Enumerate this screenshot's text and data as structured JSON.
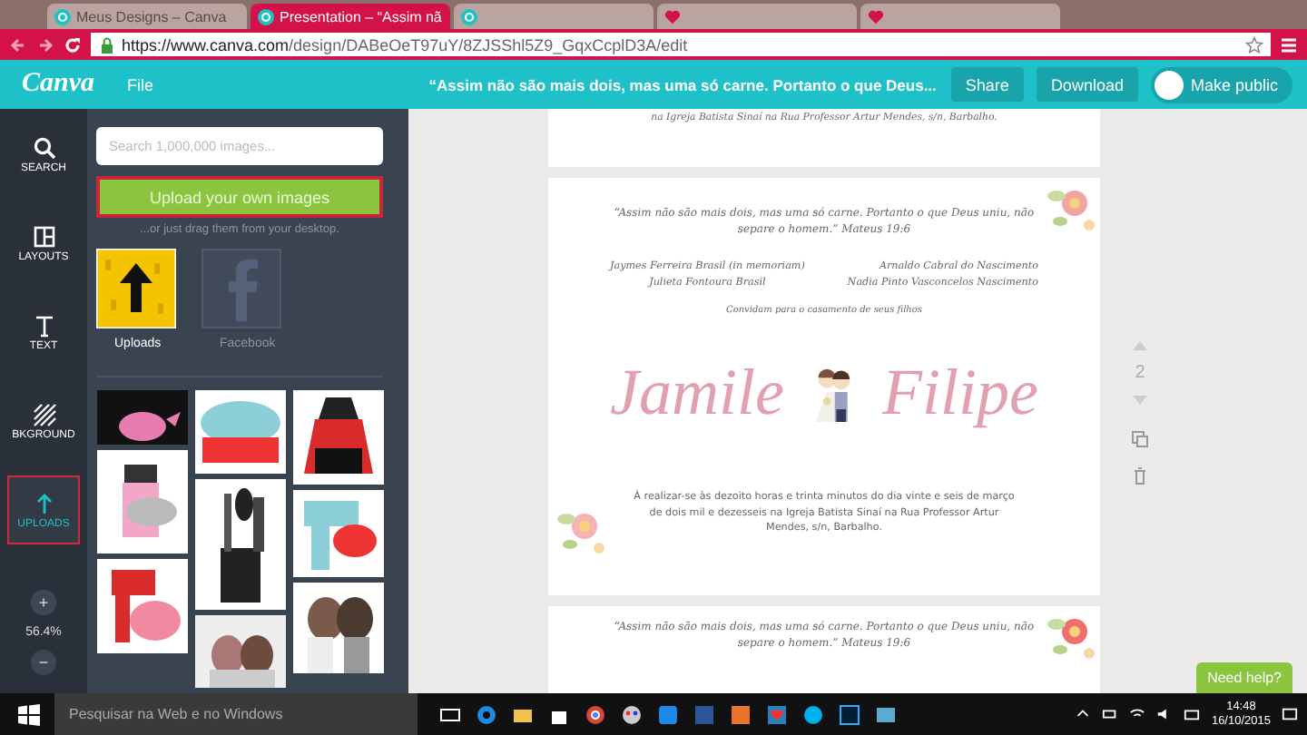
{
  "browser": {
    "tabs": [
      {
        "title": "Meus Designs – Canva",
        "kind": "canva",
        "selected": false
      },
      {
        "title": "Presentation – “Assim nã",
        "kind": "canva",
        "selected": true
      },
      {
        "kind": "canva",
        "selected": false
      },
      {
        "kind": "heart",
        "selected": false
      },
      {
        "kind": "heart",
        "selected": false
      }
    ],
    "address": {
      "host": "https://www.canva.com",
      "path": "/design/DABeOeT97uY/8ZJSShl5Z9_GqxCcplD3A/edit"
    }
  },
  "header": {
    "logo": "Canva",
    "menu": "File",
    "title": "“Assim não são mais dois, mas uma só carne. Portanto o que Deus...",
    "buttons": [
      "Share",
      "Download"
    ],
    "make_public": {
      "label": "Make public",
      "on": false
    }
  },
  "rail": {
    "items": [
      {
        "label": "SEARCH",
        "kind": "search",
        "selected": false
      },
      {
        "label": "LAYOUTS",
        "kind": "layouts",
        "selected": false
      },
      {
        "label": "TEXT",
        "kind": "text",
        "selected": false
      },
      {
        "label": "BKGROUND",
        "kind": "background",
        "selected": false
      },
      {
        "label": "UPLOADS",
        "kind": "uploads",
        "selected": true
      }
    ],
    "zoom": {
      "plus": "+",
      "value": "56.4%",
      "minus": "−"
    }
  },
  "panel": {
    "search": {
      "placeholder": "Search 1,000,000 images..."
    },
    "upload_button": "Upload your own images",
    "hint": "...or just drag them from your desktop.",
    "sources": [
      {
        "label": "Uploads",
        "kind": "uploads",
        "selected": true
      },
      {
        "label": "Facebook",
        "kind": "facebook",
        "selected": false
      }
    ]
  },
  "design": {
    "pages": [
      {
        "kind": "tail",
        "details": "na Igreja Batista Sinaí na Rua Professor Artur Mendes, s/n, Barbalho."
      },
      {
        "kind": "invitation",
        "quote": "“Assim não são mais dois, mas uma só carne. Portanto o que Deus uniu, não separe o homem.” Mateus 19:6",
        "parents_left": [
          "Jaymes Ferreira Brasil (in memoriam)",
          "Julieta Fontoura Brasil"
        ],
        "parents_right": [
          "Arnaldo Cabral do Nascimento",
          "Nadia Pinto Vasconcelos Nascimento"
        ],
        "invite_line": "Convidam para o casamento de seus filhos",
        "bride": "Jamile",
        "groom": "Filipe",
        "details": "À realizar-se às dezoito horas e trinta minutos do dia vinte e seis de março de dois mil e dezesseis na Igreja Batista Sinaí na Rua Professor Artur Mendes, s/n, Barbalho."
      },
      {
        "kind": "head",
        "quote": "“Assim não são mais dois, mas uma só carne. Portanto o que Deus uniu, não separe o homem.” Mateus 19:6"
      }
    ]
  },
  "page_tools": {
    "page_number": "2"
  },
  "help_button": "Need help?",
  "taskbar": {
    "search": {
      "placeholder": "Pesquisar na Web e no Windows"
    },
    "time": "14:48",
    "date": "16/10/2015"
  }
}
